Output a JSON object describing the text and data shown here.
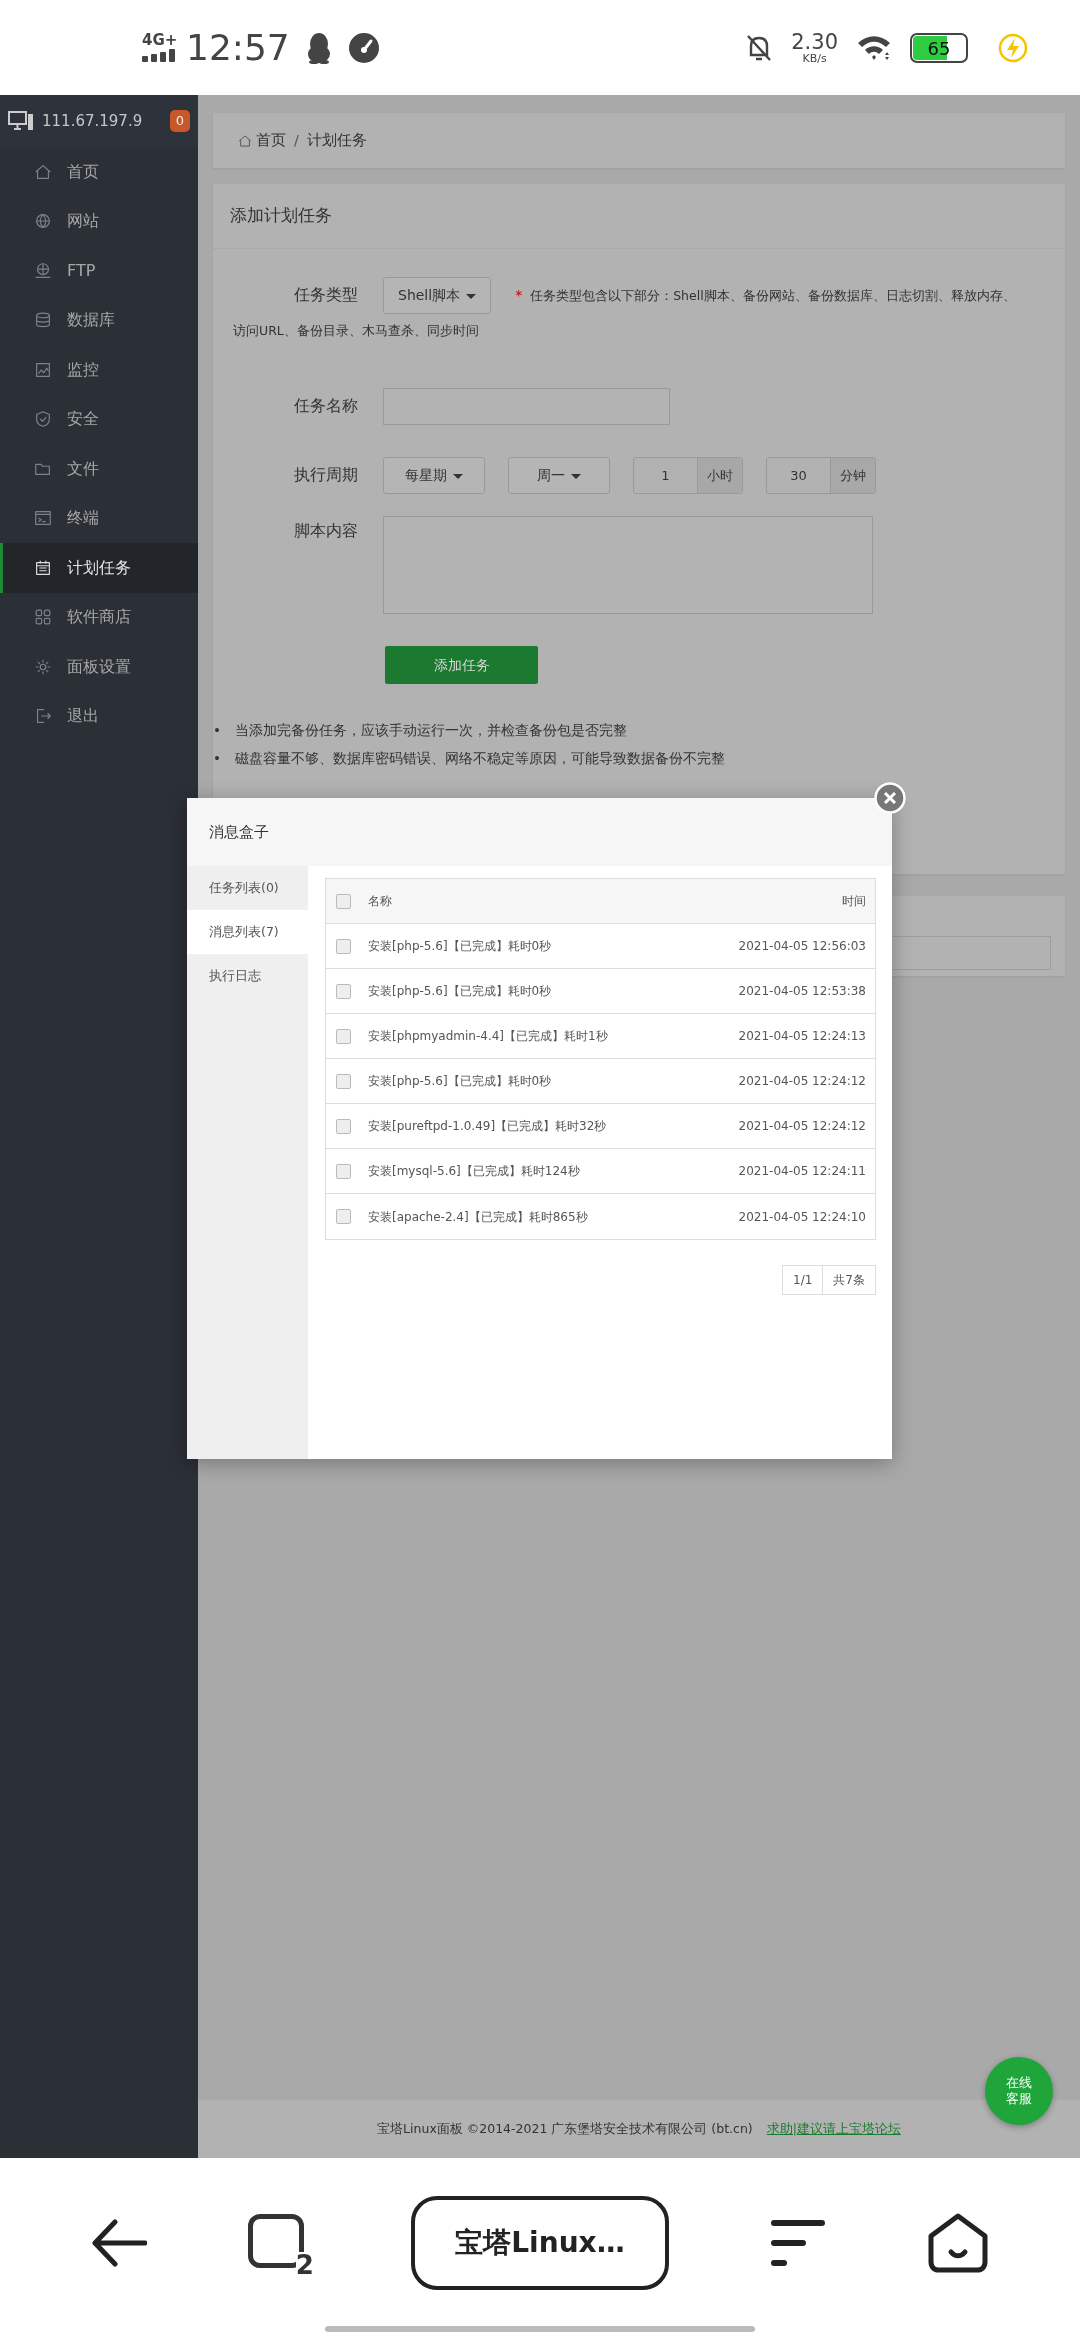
{
  "status_bar": {
    "network": "4G+",
    "time": "12:57",
    "speed": "2.30",
    "speed_unit": "KB/s",
    "battery": "65"
  },
  "sidebar": {
    "ip": "111.67.197.9",
    "badge": "0",
    "items": [
      {
        "label": "首页",
        "selected": false
      },
      {
        "label": "网站",
        "selected": false
      },
      {
        "label": "FTP",
        "selected": false
      },
      {
        "label": "数据库",
        "selected": false
      },
      {
        "label": "监控",
        "selected": false
      },
      {
        "label": "安全",
        "selected": false
      },
      {
        "label": "文件",
        "selected": false
      },
      {
        "label": "终端",
        "selected": false
      },
      {
        "label": "计划任务",
        "selected": true
      },
      {
        "label": "软件商店",
        "selected": false
      },
      {
        "label": "面板设置",
        "selected": false
      },
      {
        "label": "退出",
        "selected": false
      }
    ]
  },
  "breadcrumb": [
    "首页",
    "计划任务"
  ],
  "breadcrumb_separator": "/",
  "form": {
    "title": "添加计划任务",
    "type_label": "任务类型",
    "type_value": "Shell脚本",
    "required_mark": "*",
    "type_hint": "任务类型包含以下部分：Shell脚本、备份网站、备份数据库、日志切割、释放内存、",
    "type_hint_more": "访问URL、备份目录、木马查杀、同步时间",
    "name_label": "任务名称",
    "period_label": "执行周期",
    "period_value": "每星期",
    "weekday_value": "周一",
    "hour_value": "1",
    "hour_unit": "小时",
    "minute_value": "30",
    "minute_unit": "分钟",
    "script_label": "脚本内容",
    "submit": "添加任务"
  },
  "notes": [
    {
      "marker": "•",
      "text": "当添加完备份任务，应该手动运行一次，并检查备份包是否完整"
    },
    {
      "marker": "•",
      "text": "磁盘容量不够、数据库密码错误、网络不稳定等原因，可能导致数据备份不完整"
    }
  ],
  "modal": {
    "title": "消息盒子",
    "tabs": [
      {
        "label": "任务列表(0)",
        "selected": false
      },
      {
        "label": "消息列表(7)",
        "selected": true
      },
      {
        "label": "执行日志",
        "selected": false
      }
    ],
    "columns": [
      "名称",
      "时间"
    ],
    "all_checked": false,
    "rows": [
      {
        "name": "安装[php-5.6]【已完成】耗时0秒",
        "time": "2021-04-05 12:56:03",
        "checked": false
      },
      {
        "name": "安装[php-5.6]【已完成】耗时0秒",
        "time": "2021-04-05 12:53:38",
        "checked": false
      },
      {
        "name": "安装[phpmyadmin-4.4]【已完成】耗时1秒",
        "time": "2021-04-05 12:24:13",
        "checked": false
      },
      {
        "name": "安装[php-5.6]【已完成】耗时0秒",
        "time": "2021-04-05 12:24:12",
        "checked": false
      },
      {
        "name": "安装[pureftpd-1.0.49]【已完成】耗时32秒",
        "time": "2021-04-05 12:24:12",
        "checked": false
      },
      {
        "name": "安装[mysql-5.6]【已完成】耗时124秒",
        "time": "2021-04-05 12:24:11",
        "checked": false
      },
      {
        "name": "安装[apache-2.4]【已完成】耗时865秒",
        "time": "2021-04-05 12:24:10",
        "checked": false
      }
    ],
    "pagination": {
      "page": "1/1",
      "total": "共7条"
    }
  },
  "footer": {
    "text": "宝塔Linux面板 ©2014-2021 广东堡塔安全技术有限公司 (bt.cn)",
    "link": "求助|建议请上宝塔论坛"
  },
  "chat_button": [
    "在线",
    "客服"
  ],
  "browser_nav": {
    "tab_count": "2",
    "title": "宝塔Linux…"
  }
}
